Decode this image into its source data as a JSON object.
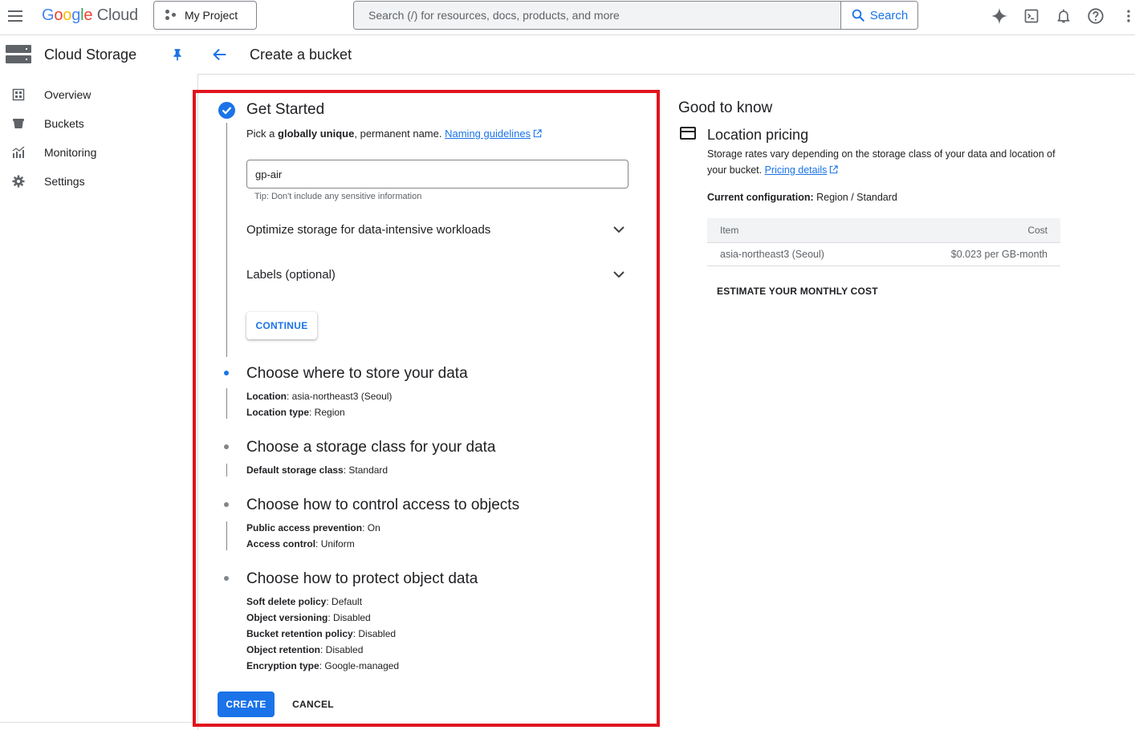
{
  "topbar": {
    "logo_google": "Google",
    "logo_cloud": "Cloud",
    "project_label": "My Project",
    "search_placeholder": "Search (/) for resources, docs, products, and more",
    "search_button": "Search",
    "icons": [
      "gemini-icon",
      "terminal-icon",
      "bell-icon",
      "help-icon",
      "more-vert-icon"
    ]
  },
  "sidebar": {
    "product_title": "Cloud Storage",
    "items": [
      {
        "label": "Overview",
        "icon": "overview-icon"
      },
      {
        "label": "Buckets",
        "icon": "bucket-icon"
      },
      {
        "label": "Monitoring",
        "icon": "monitoring-icon"
      },
      {
        "label": "Settings",
        "icon": "gear-icon"
      }
    ]
  },
  "page": {
    "title": "Create a bucket"
  },
  "form": {
    "get_started": {
      "title": "Get Started",
      "intro_prefix": "Pick a ",
      "intro_bold": "globally unique",
      "intro_suffix": ", permanent name.",
      "naming_link": "Naming guidelines",
      "name_value": "gp-air",
      "tip": "Tip: Don't include any sensitive information",
      "optimize_label": "Optimize storage for data-intensive workloads",
      "labels_label": "Labels (optional)",
      "continue_label": "CONTINUE"
    },
    "steps": [
      {
        "title": "Choose where to store your data",
        "details": [
          {
            "key": "Location",
            "value": ": asia-northeast3 (Seoul)"
          },
          {
            "key": "Location type",
            "value": ": Region"
          }
        ]
      },
      {
        "title": "Choose a storage class for your data",
        "details": [
          {
            "key": "Default storage class",
            "value": ": Standard"
          }
        ]
      },
      {
        "title": "Choose how to control access to objects",
        "details": [
          {
            "key": "Public access prevention",
            "value": ": On"
          },
          {
            "key": "Access control",
            "value": ": Uniform"
          }
        ]
      },
      {
        "title": "Choose how to protect object data",
        "details": [
          {
            "key": "Soft delete policy",
            "value": ": Default"
          },
          {
            "key": "Object versioning",
            "value": ": Disabled"
          },
          {
            "key": "Bucket retention policy",
            "value": ": Disabled"
          },
          {
            "key": "Object retention",
            "value": ": Disabled"
          },
          {
            "key": "Encryption type",
            "value": ": Google-managed"
          }
        ]
      }
    ],
    "create_label": "CREATE",
    "cancel_label": "CANCEL"
  },
  "good_to_know": {
    "title": "Good to know",
    "location_pricing_title": "Location pricing",
    "desc": "Storage rates vary depending on the storage class of your data and location of your bucket.",
    "pricing_link": "Pricing details",
    "config_label": "Current configuration:",
    "config_value": " Region / Standard",
    "table": {
      "headers": [
        "Item",
        "Cost"
      ],
      "rows": [
        [
          "asia-northeast3 (Seoul)",
          "$0.023 per GB-month"
        ]
      ]
    },
    "estimate_label": "ESTIMATE YOUR MONTHLY COST"
  },
  "colors": {
    "accent": "#1a73e8",
    "highlight_border": "#e0141e",
    "text": "#202124",
    "muted": "#5f6368"
  }
}
